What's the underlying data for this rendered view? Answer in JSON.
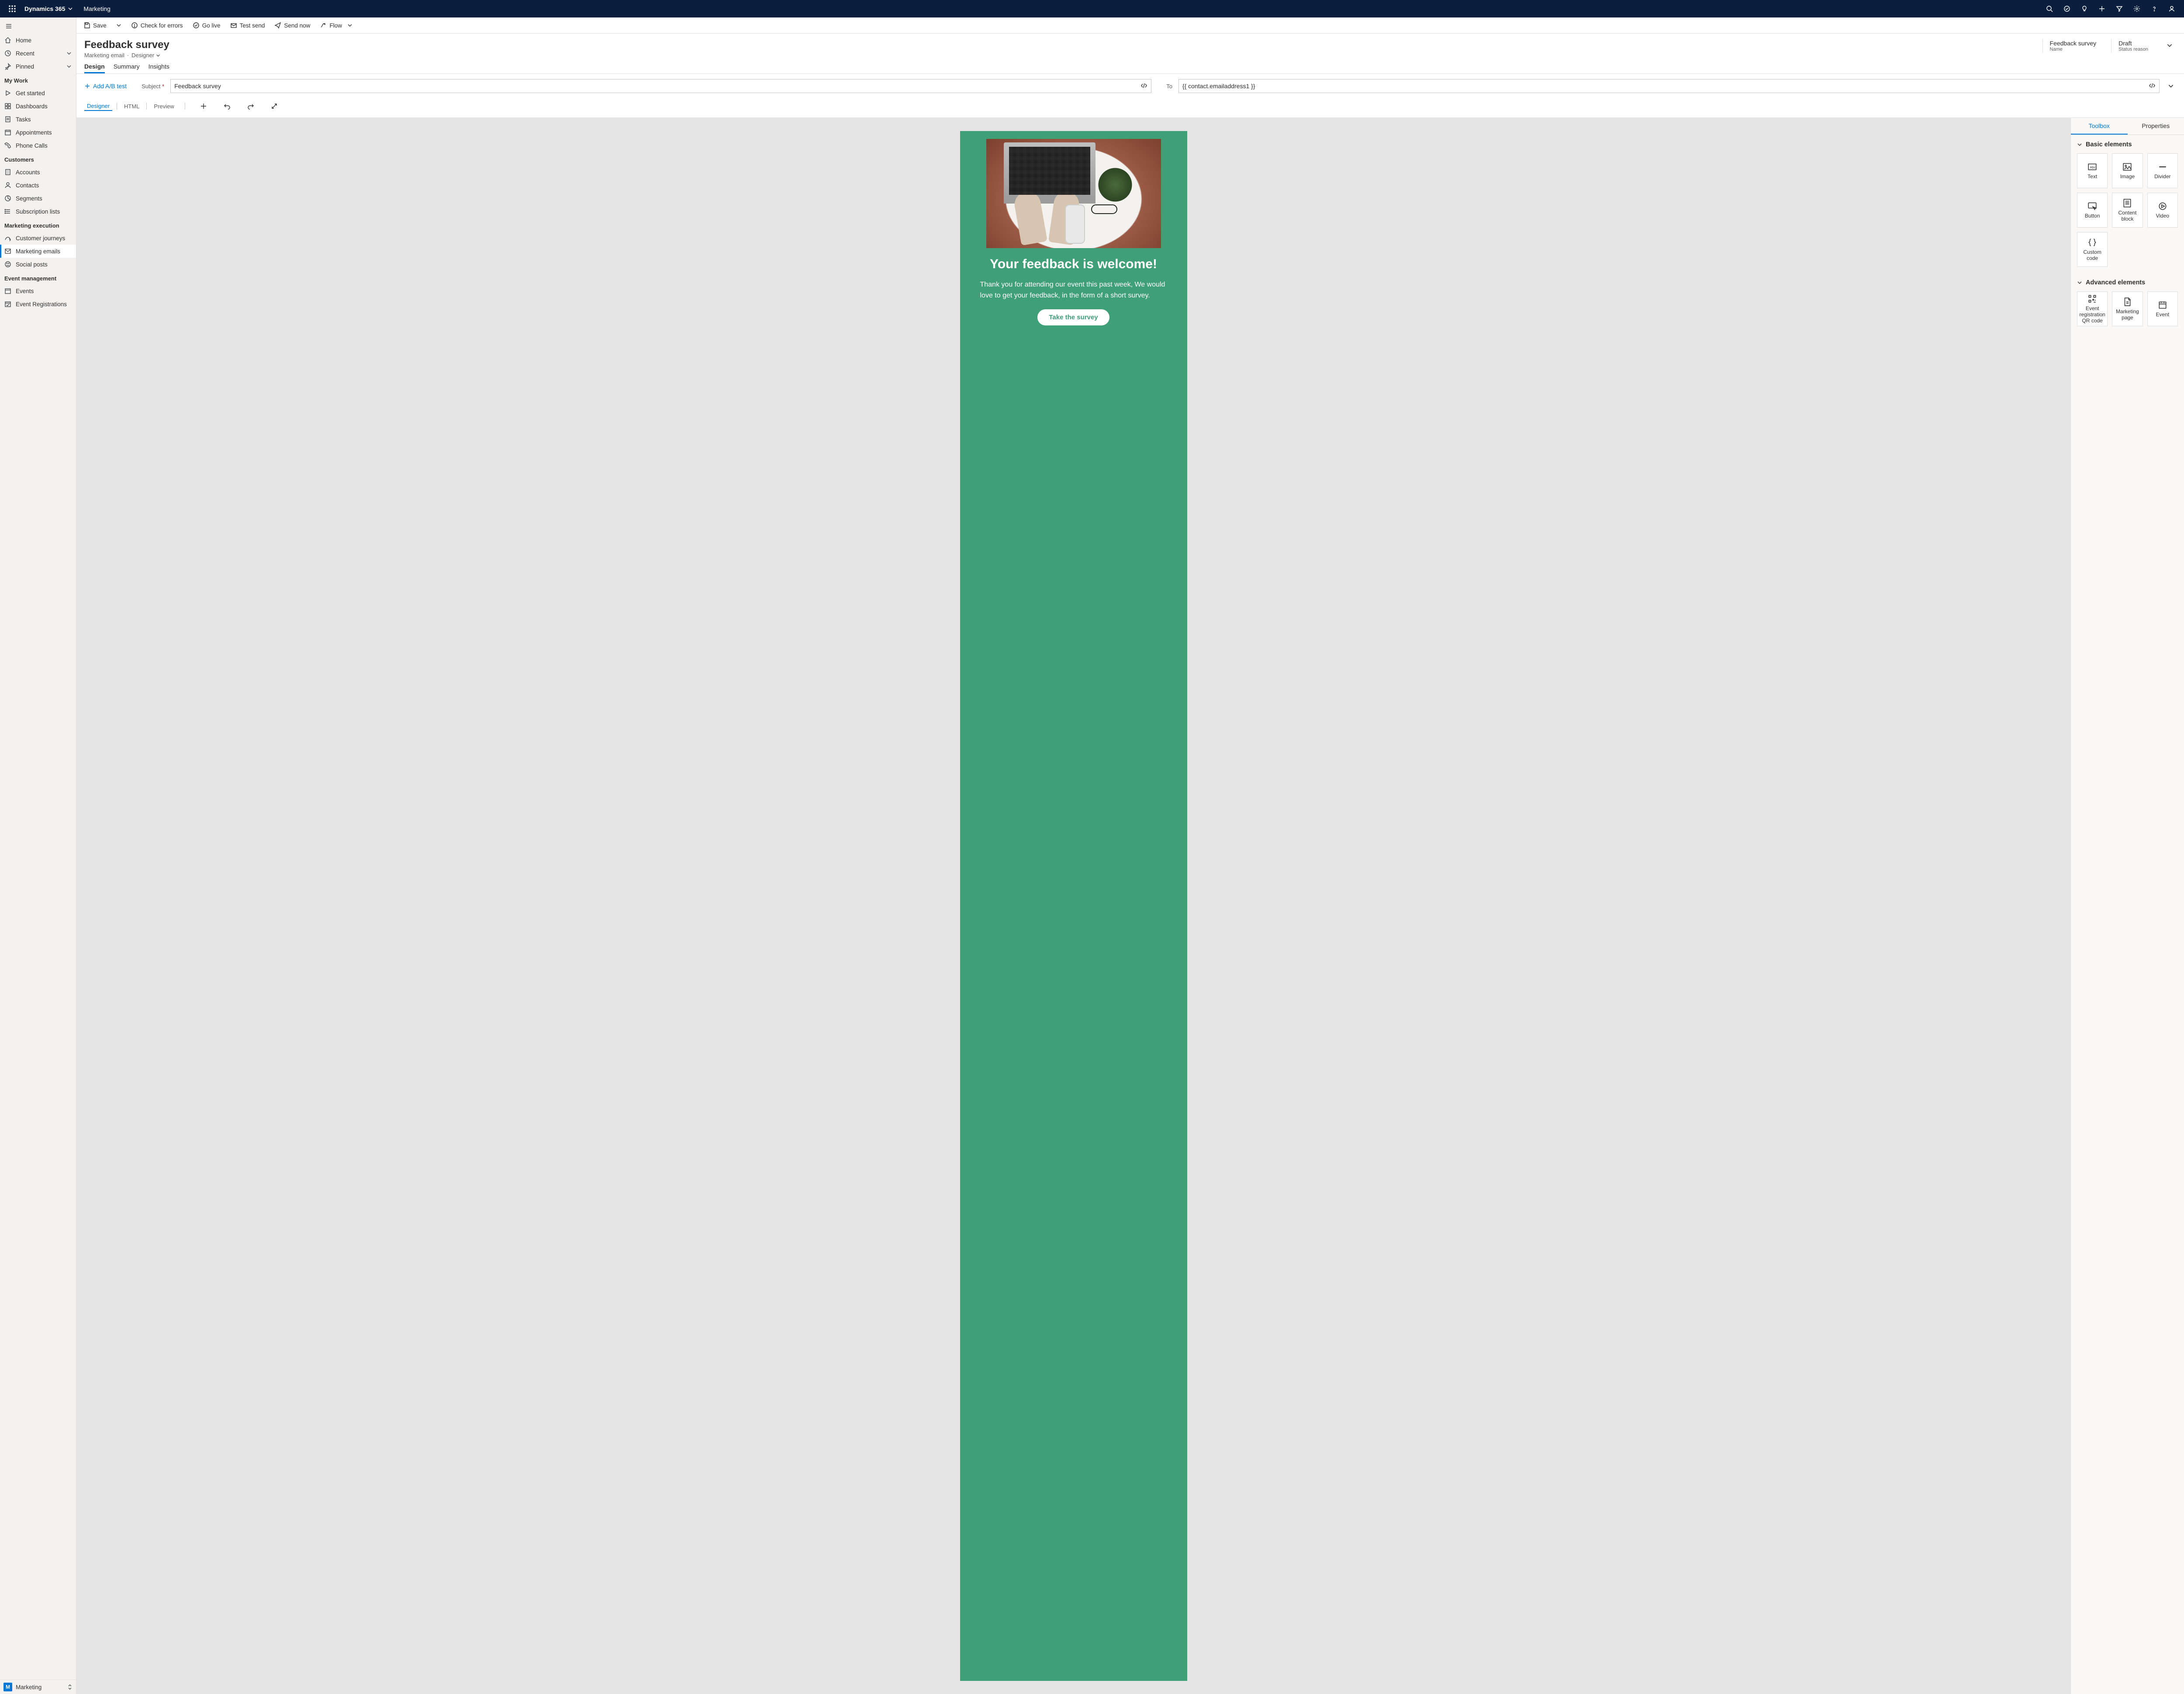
{
  "topbar": {
    "brand": "Dynamics 365",
    "area": "Marketing"
  },
  "sidebar": {
    "primary": {
      "home": "Home",
      "recent": "Recent",
      "pinned": "Pinned"
    },
    "sections": [
      {
        "title": "My Work",
        "items": [
          "Get started",
          "Dashboards",
          "Tasks",
          "Appointments",
          "Phone Calls"
        ]
      },
      {
        "title": "Customers",
        "items": [
          "Accounts",
          "Contacts",
          "Segments",
          "Subscription lists"
        ]
      },
      {
        "title": "Marketing execution",
        "items": [
          "Customer journeys",
          "Marketing emails",
          "Social posts"
        ]
      },
      {
        "title": "Event management",
        "items": [
          "Events",
          "Event Registrations"
        ]
      }
    ],
    "areaSwitcher": {
      "letter": "M",
      "label": "Marketing"
    }
  },
  "commands": {
    "save": "Save",
    "check": "Check for errors",
    "golive": "Go live",
    "testsend": "Test send",
    "sendnow": "Send now",
    "flow": "Flow"
  },
  "record": {
    "title": "Feedback survey",
    "entity": "Marketing email",
    "formName": "Designer",
    "status1": {
      "value": "Feedback survey",
      "label": "Name"
    },
    "status2": {
      "value": "Draft",
      "label": "Status reason"
    }
  },
  "tabs": [
    "Design",
    "Summary",
    "Insights"
  ],
  "fields": {
    "addAb": "Add A/B test",
    "subjectLabel": "Subject",
    "subjectValue": "Feedback survey",
    "toLabel": "To",
    "toValue": "{{ contact.emailaddress1 }}"
  },
  "editorTabs": [
    "Designer",
    "HTML",
    "Preview"
  ],
  "email": {
    "heading": "Your feedback is welcome!",
    "body": "Thank you for attending our event this past week, We would love to get your feedback, in the form of a short survey.",
    "cta": "Take the survey"
  },
  "toolbox": {
    "tabs": [
      "Toolbox",
      "Properties"
    ],
    "groups": [
      {
        "title": "Basic elements",
        "tiles": [
          "Text",
          "Image",
          "Divider",
          "Button",
          "Content block",
          "Video",
          "Custom code"
        ]
      },
      {
        "title": "Advanced elements",
        "tiles": [
          "Event registration QR code",
          "Marketing page",
          "Event"
        ]
      }
    ]
  }
}
